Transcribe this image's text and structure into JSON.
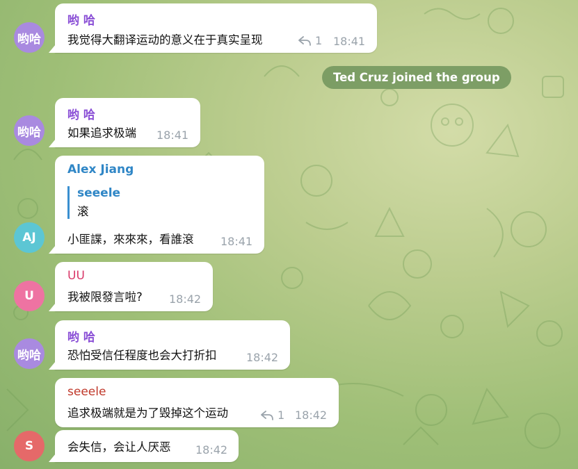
{
  "colors": {
    "background": "#a9c47f",
    "bubble": "#ffffff",
    "time": "#9aa3ab",
    "service_bg": "#70945c",
    "quote_bar": "#3a8fd0"
  },
  "service_message": "Ted Cruz joined the group",
  "avatars": {
    "youha": {
      "initials": "哟哈",
      "color": "#a98ae0"
    },
    "aj": {
      "initials": "AJ",
      "color": "#5cc6d4"
    },
    "uu": {
      "initials": "U",
      "color": "#ee73a2"
    },
    "seeele": {
      "initials": "S",
      "color": "#e56969"
    }
  },
  "messages": [
    {
      "sender": "哟 哈",
      "sender_color": "#8a4fd6",
      "text": "我觉得大翻译运动的意义在于真实呈现",
      "replies": "1",
      "time": "18:41"
    },
    {
      "sender": "哟 哈",
      "sender_color": "#8a4fd6",
      "text": "如果追求极端",
      "time": "18:41"
    },
    {
      "sender": "Alex Jiang",
      "sender_color": "#2f86c6",
      "quote_name": "seeele",
      "quote_text": "滚",
      "text": "小匪諜，來來來，看誰滾",
      "time": "18:41"
    },
    {
      "sender": "UU",
      "sender_color": "#d93a6a",
      "text": "我被限發言啦?",
      "time": "18:42"
    },
    {
      "sender": "哟 哈",
      "sender_color": "#8a4fd6",
      "text": "恐怕受信任程度也会大打折扣",
      "time": "18:42"
    },
    {
      "sender": "seeele",
      "sender_color": "#c0392b",
      "text": "追求极端就是为了毁掉这个运动",
      "replies": "1",
      "time": "18:42"
    },
    {
      "text": "会失信，会让人厌恶",
      "time": "18:42"
    }
  ]
}
